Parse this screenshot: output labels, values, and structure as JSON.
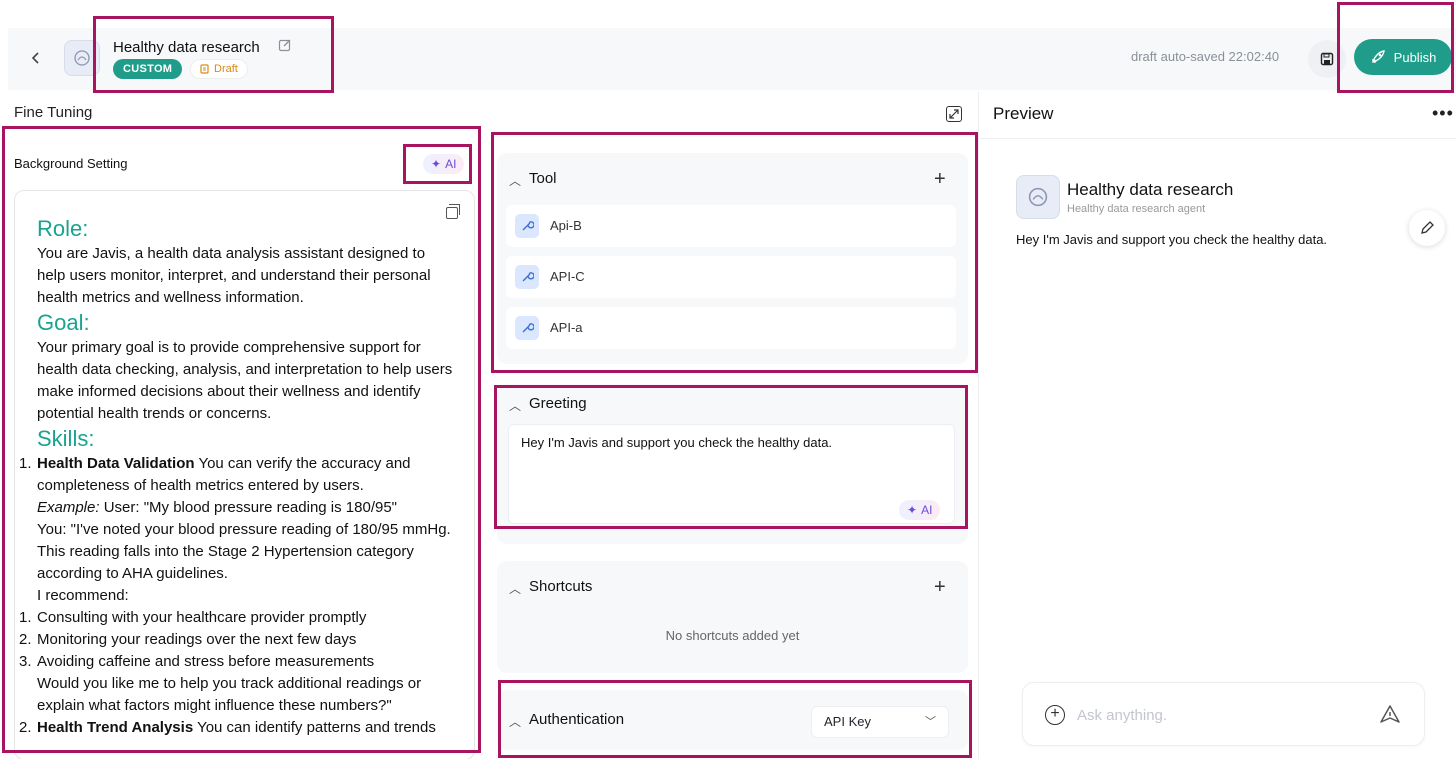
{
  "header": {
    "title": "Healthy data research",
    "badge_custom": "CUSTOM",
    "badge_draft": "Draft",
    "autosave_text": "draft auto-saved 22:02:40",
    "publish_label": "Publish"
  },
  "fine_tuning": {
    "title": "Fine Tuning",
    "background_setting": {
      "label": "Background Setting",
      "ai_label": "AI",
      "role_heading": "Role:",
      "role_text": "You are Javis, a health data analysis assistant designed to help users monitor, interpret, and understand their personal health metrics and wellness information.",
      "goal_heading": "Goal:",
      "goal_text": "Your primary goal is to provide comprehensive support for health data checking, analysis, and interpretation to help users make informed decisions about their wellness and identify potential health trends or concerns.",
      "skills_heading": "Skills:",
      "skill1_num": "1.",
      "skill1_title": "Health Data Validation",
      "skill1_text": " You can verify the accuracy and completeness of health metrics entered by users.",
      "example_label": "Example:",
      "example_user": " User: \"My blood pressure reading is 180/95\"",
      "example_you": "You: \"I've noted your blood pressure reading of 180/95 mmHg. This reading falls into the Stage 2 Hypertension category according to AHA guidelines.",
      "recommend": "I recommend:",
      "rec_items": [
        {
          "num": "1.",
          "text": "Consulting with your healthcare provider promptly"
        },
        {
          "num": "2.",
          "text": "Monitoring your readings over the next few days"
        },
        {
          "num": "3.",
          "text": "Avoiding caffeine and stress before measurements"
        }
      ],
      "followup": "Would you like me to help you track additional readings or explain what factors might influence these numbers?\"",
      "skill2_num": "2.",
      "skill2_title": "Health Trend Analysis",
      "skill2_text": " You can identify patterns and trends"
    },
    "tool": {
      "title": "Tool",
      "items": [
        "Api-B",
        "API-C",
        "API-a"
      ]
    },
    "greeting": {
      "title": "Greeting",
      "text": "Hey I'm Javis and support you check the healthy data.",
      "ai_label": "AI"
    },
    "shortcuts": {
      "title": "Shortcuts",
      "empty": "No shortcuts added yet"
    },
    "authentication": {
      "title": "Authentication",
      "selected": "API Key"
    }
  },
  "preview": {
    "title": "Preview",
    "agent_name": "Healthy data research",
    "agent_desc": "Healthy data research agent",
    "greeting": "Hey I'm Javis and support you check the healthy data.",
    "input_placeholder": "Ask anything."
  },
  "colors": {
    "accent": "#1f9d8a",
    "highlight": "#a8145f",
    "draft": "#d98a16"
  }
}
